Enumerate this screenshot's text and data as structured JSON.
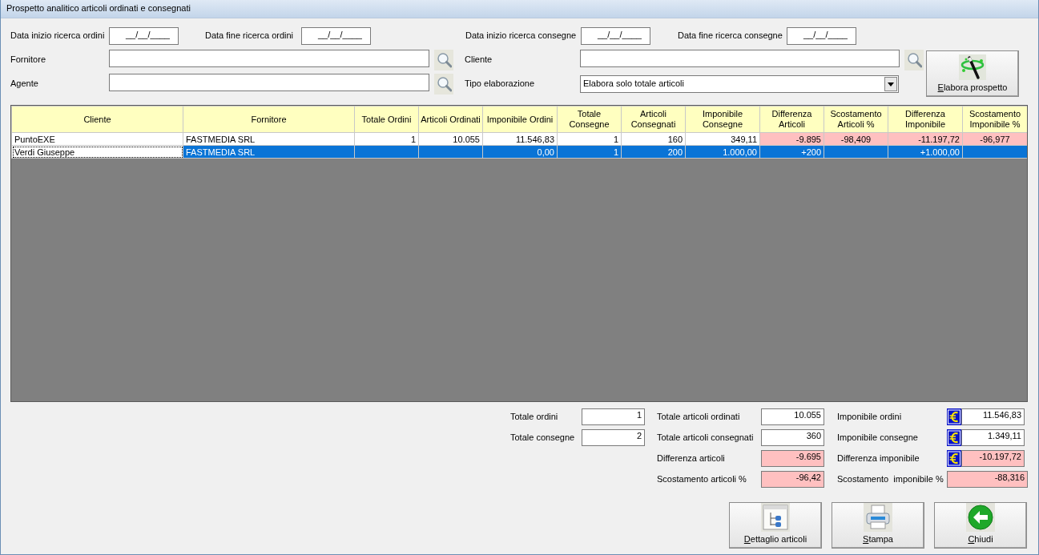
{
  "window": {
    "title": "Prospetto analitico articoli ordinati e consegnati"
  },
  "filters": {
    "order_start": {
      "label": "Data inizio ricerca ordini",
      "value": "__/__/____"
    },
    "order_end": {
      "label": "Data fine ricerca ordini",
      "value": "__/__/____"
    },
    "delivery_start": {
      "label": "Data inizio ricerca consegne",
      "value": "__/__/____"
    },
    "delivery_end": {
      "label": "Data fine ricerca consegne",
      "value": "__/__/____"
    },
    "supplier": {
      "label": "Fornitore"
    },
    "customer": {
      "label": "Cliente"
    },
    "agent": {
      "label": "Agente"
    },
    "processing_type": {
      "label": "Tipo elaborazione",
      "value": "Elabora solo totale articoli"
    }
  },
  "process_button": {
    "label": "Elabora prospetto"
  },
  "table": {
    "columns": [
      "Cliente",
      "Fornitore",
      "Totale Ordini",
      "Articoli Ordinati",
      "Imponibile Ordini",
      "Totale Consegne",
      "Articoli Consegnati",
      "Imponibile Consegne",
      "Differenza Articoli",
      "Scostamento Articoli %",
      "Differenza Imponibile",
      "Scostamento Imponibile %"
    ],
    "rows": [
      {
        "selected": false,
        "cells": [
          {
            "text": "PuntoEXE",
            "alert": false,
            "focused": false
          },
          {
            "text": "FASTMEDIA SRL",
            "alert": false,
            "focused": false
          },
          {
            "text": "1",
            "alert": false,
            "focused": false
          },
          {
            "text": "10.055",
            "alert": false,
            "focused": false
          },
          {
            "text": "11.546,83",
            "alert": false,
            "focused": false
          },
          {
            "text": "1",
            "alert": false,
            "focused": false
          },
          {
            "text": "160",
            "alert": false,
            "focused": false
          },
          {
            "text": "349,11",
            "alert": false,
            "focused": false
          },
          {
            "text": "-9.895",
            "alert": true,
            "focused": false
          },
          {
            "text": "-98,409",
            "alert": true,
            "focused": false
          },
          {
            "text": "-11.197,72",
            "alert": true,
            "focused": false
          },
          {
            "text": "-96,977",
            "alert": true,
            "focused": false
          }
        ]
      },
      {
        "selected": true,
        "cells": [
          {
            "text": "Verdi Giuseppe",
            "alert": false,
            "focused": true
          },
          {
            "text": "FASTMEDIA SRL",
            "alert": false,
            "focused": false
          },
          {
            "alert": false,
            "focused": false
          },
          {
            "alert": false,
            "focused": false
          },
          {
            "text": "0,00",
            "alert": false,
            "focused": false
          },
          {
            "text": "1",
            "alert": false,
            "focused": false
          },
          {
            "text": "200",
            "alert": false,
            "focused": false
          },
          {
            "text": "1.000,00",
            "alert": false,
            "focused": false
          },
          {
            "text": "+200",
            "alert": false,
            "focused": false
          },
          {
            "alert": false,
            "focused": false
          },
          {
            "text": "+1.000,00",
            "alert": false,
            "focused": false
          },
          {
            "alert": false,
            "focused": false
          }
        ]
      }
    ]
  },
  "summary": [
    [
      {
        "label": "Totale ordini",
        "value": "1",
        "alert": false,
        "currency": false
      },
      {
        "label": "Totale consegne",
        "value": "2",
        "alert": false,
        "currency": false
      }
    ],
    [
      {
        "label": "Totale articoli ordinati",
        "value": "10.055",
        "alert": false,
        "currency": false
      },
      {
        "label": "Totale articoli consegnati",
        "value": "360",
        "alert": false,
        "currency": false
      },
      {
        "label": "Differenza articoli",
        "value": "-9.695",
        "alert": true,
        "currency": false
      },
      {
        "label": "Scostamento articoli %",
        "value": "-96,42",
        "alert": true,
        "currency": false
      }
    ],
    [
      {
        "label": "Imponibile ordini",
        "value": "11.546,83",
        "alert": false,
        "currency": true
      },
      {
        "label": "Imponibile consegne",
        "value": "1.349,11",
        "alert": false,
        "currency": true
      },
      {
        "label": "Differenza imponibile",
        "value": "-10.197,72",
        "alert": true,
        "currency": true
      },
      {
        "label": "Scostamento  imponibile %",
        "value": "-88,316",
        "alert": true,
        "currency": false
      }
    ]
  ],
  "buttons": [
    {
      "kind": "detail",
      "label": "Dettaglio articoli"
    },
    {
      "kind": "print",
      "label": "Stampa"
    },
    {
      "kind": "close",
      "label": "Chiudi"
    }
  ]
}
